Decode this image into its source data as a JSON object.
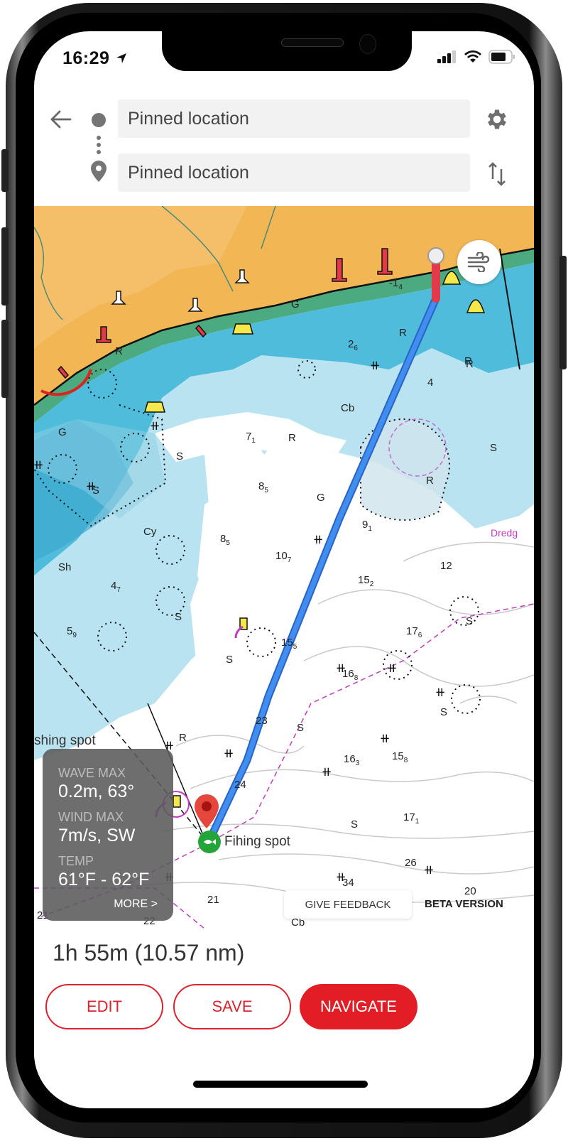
{
  "status_bar": {
    "time": "16:29",
    "location_icon": "location-arrow-icon",
    "signal_icon": "cellular-signal-icon",
    "wifi_icon": "wifi-icon",
    "battery_icon": "battery-icon"
  },
  "header": {
    "back_icon": "arrow-left-icon",
    "origin": {
      "icon": "dot-icon",
      "value": "Pinned location"
    },
    "destination": {
      "icon": "map-pin-icon",
      "value": "Pinned location"
    },
    "settings_icon": "gear-icon",
    "swap_icon": "swap-vertical-icon"
  },
  "map": {
    "wind_button_icon": "wind-icon",
    "destination_label": "Fihing spot",
    "partial_label": "shing spot",
    "dredge_label": "Dredg",
    "weather_card": {
      "wave_label": "WAVE MAX",
      "wave_value": "0.2m, 63°",
      "wind_label": "WIND MAX",
      "wind_value": "7m/s, SW",
      "temp_label": "TEMP",
      "temp_value": "61°F - 62°F",
      "more_label": "MORE >"
    },
    "feedback_label": "GIVE FEEDBACK",
    "beta_label": "BETA VERSION",
    "soundings": [
      {
        "t": "G"
      },
      {
        "t": "R"
      },
      {
        "t": "R"
      },
      {
        "t": "R"
      },
      {
        "t": "G"
      },
      {
        "t": "S"
      },
      {
        "t": "S"
      },
      {
        "t": "Cy"
      },
      {
        "t": "Sh"
      },
      {
        "t": "S"
      },
      {
        "t": "S"
      },
      {
        "t": "Cb"
      },
      {
        "t": "R"
      },
      {
        "t": "R"
      },
      {
        "t": "R"
      },
      {
        "t": "G"
      },
      {
        "t": "S"
      },
      {
        "t": "S"
      },
      {
        "t": "S"
      },
      {
        "t": "S"
      },
      {
        "t": "S"
      },
      {
        "t": "Cb"
      },
      {
        "t": "R"
      }
    ],
    "depths": [
      {
        "d": "-1",
        "s": "4"
      },
      {
        "d": "2",
        "s": "6"
      },
      {
        "d": "4",
        "s": ""
      },
      {
        "d": "7",
        "s": "1"
      },
      {
        "d": "8",
        "s": "5"
      },
      {
        "d": "8",
        "s": "5"
      },
      {
        "d": "9",
        "s": "1"
      },
      {
        "d": "10",
        "s": "7"
      },
      {
        "d": "12",
        "s": ""
      },
      {
        "d": "15",
        "s": "2"
      },
      {
        "d": "4",
        "s": "7"
      },
      {
        "d": "5",
        "s": "9"
      },
      {
        "d": "15",
        "s": "5"
      },
      {
        "d": "17",
        "s": "6"
      },
      {
        "d": "16",
        "s": "8"
      },
      {
        "d": "23",
        "s": ""
      },
      {
        "d": "16",
        "s": "3"
      },
      {
        "d": "15",
        "s": "8"
      },
      {
        "d": "24",
        "s": ""
      },
      {
        "d": "17",
        "s": "1"
      },
      {
        "d": "26",
        "s": ""
      },
      {
        "d": "34",
        "s": ""
      },
      {
        "d": "21",
        "s": ""
      },
      {
        "d": "20",
        "s": ""
      },
      {
        "d": "21",
        "s": ""
      },
      {
        "d": "22",
        "s": ""
      }
    ]
  },
  "route": {
    "duration": "1h 55m (10.57 nm)",
    "edit_label": "EDIT",
    "save_label": "SAVE",
    "navigate_label": "NAVIGATE"
  },
  "colors": {
    "accent": "#e21d26",
    "route": "#3a7fe0",
    "land": "#f3b655",
    "shallow": "#4fbcdb",
    "mid": "#b9e3f0",
    "deep": "#ffffff",
    "coast": "#4caa80"
  }
}
